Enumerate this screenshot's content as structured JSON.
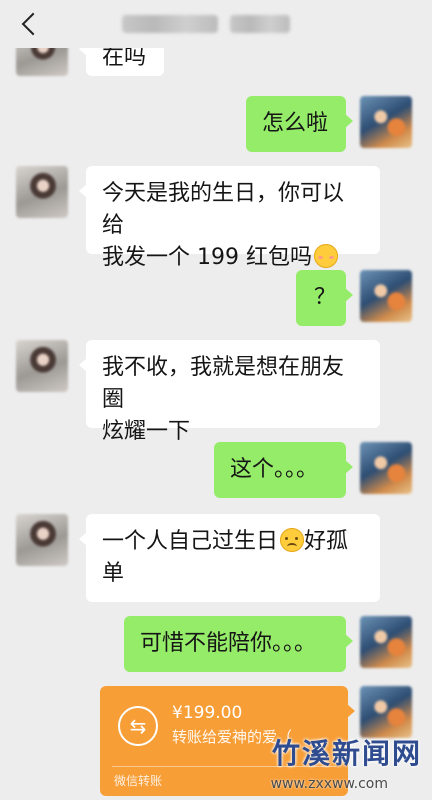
{
  "header": {
    "back_icon": "chevron-left-icon"
  },
  "messages": [
    {
      "side": "left",
      "text": "在吗",
      "partial": true
    },
    {
      "side": "right",
      "text": "怎么啦"
    },
    {
      "side": "left",
      "text_line1": "今天是我的生日，你可以给",
      "text_line2": "我发一个 199 红包吗",
      "emoji": "blush-smile-emoji"
    },
    {
      "side": "right",
      "text": "？"
    },
    {
      "side": "left",
      "text_line1": "我不收，我就是想在朋友圈",
      "text_line2": "炫耀一下"
    },
    {
      "side": "right",
      "text": "这个。。。"
    },
    {
      "side": "left",
      "text_line1": "一个人自己过生日",
      "text_line1_after": "好孤",
      "text_line2": "单",
      "emoji": "sad-face-emoji"
    },
    {
      "side": "right",
      "text": "可惜不能陪你。。。"
    }
  ],
  "transfer": {
    "amount": "¥199.00",
    "description": "转账给爱神的爱（",
    "footer": "微信转账",
    "color": "#f79e37"
  },
  "watermark": {
    "title": "竹溪新闻网",
    "url": "www.zxxww.com"
  },
  "colors": {
    "background": "#ededed",
    "outgoing_bubble": "#95ec69",
    "incoming_bubble": "#ffffff"
  }
}
